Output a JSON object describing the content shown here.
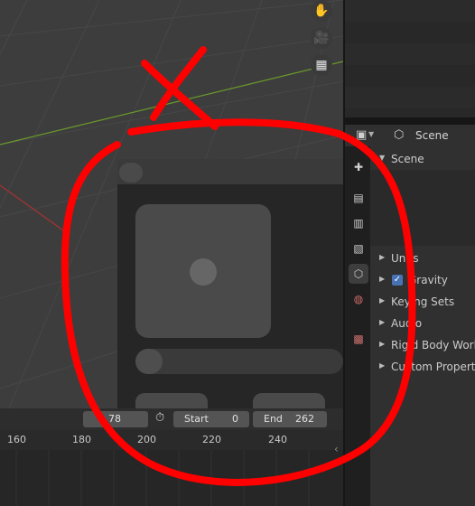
{
  "colors": {
    "viewport_bg": "#3d3d3d",
    "x_axis": "#a83232",
    "y_axis": "#6a9a2a",
    "annotation_red": "#ff0000",
    "checkbox_blue": "#4772b3"
  },
  "viewport": {
    "nav_icons": [
      "hand-icon",
      "camera-icon",
      "grid-icon"
    ]
  },
  "properties": {
    "header_label": "Scene",
    "tabs": [
      "tool-icon",
      "render-icon",
      "output-icon",
      "view-layer-icon",
      "scene-icon",
      "world-icon",
      "texture-icon"
    ],
    "scene_panel_label": "Scene",
    "sections": [
      {
        "label": "Units",
        "checkbox": false
      },
      {
        "label": "Gravity",
        "checkbox": true
      },
      {
        "label": "Keying Sets",
        "checkbox": false
      },
      {
        "label": "Audio",
        "checkbox": false
      },
      {
        "label": "Rigid Body World",
        "checkbox": false
      },
      {
        "label": "Custom Properties",
        "checkbox": false
      }
    ]
  },
  "timeline": {
    "current_frame": "78",
    "start_label": "Start",
    "start_value": "0",
    "end_label": "End",
    "end_value": "262",
    "ticks": [
      "160",
      "180",
      "200",
      "220",
      "240"
    ]
  },
  "annotation": {
    "description_free": true
  }
}
